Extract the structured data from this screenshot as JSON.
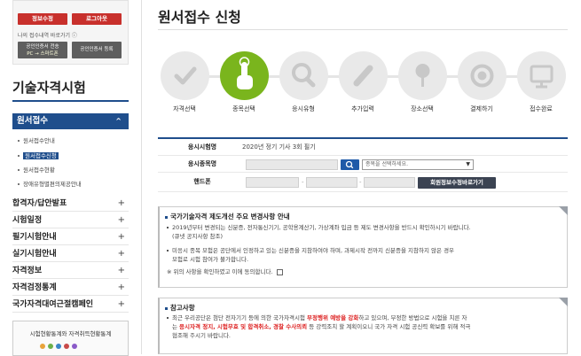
{
  "user_box": {
    "info_edit": "정보수정",
    "logout": "로그아웃",
    "receipt_link": "나의 접수내역 바로가기 ⓘ",
    "cert_transfer_line1": "공인인증서 전송",
    "cert_transfer_line2": "PC → 스마트폰",
    "cert_register": "공인인증서 등록"
  },
  "sidebar": {
    "title": "기술자격시험",
    "active_menu": "원서접수",
    "active_chev": "^",
    "sub_items": [
      "원서접수안내",
      "원서접수신청",
      "원서접수현황",
      "장애유형별편의제공안내"
    ],
    "menus": [
      "합격자/답안발표",
      "시험일정",
      "필기시험안내",
      "실기시험안내",
      "자격정보",
      "자격검정통계",
      "국가자격대여근절캠페인"
    ],
    "plus": "+",
    "stats_title": "시험현황통계와 자격취득현황통계"
  },
  "page": {
    "title": "원서접수 신청"
  },
  "steps": [
    {
      "label": "자격선택",
      "icon": "check-icon"
    },
    {
      "label": "종목선택",
      "icon": "hand-pointer-icon"
    },
    {
      "label": "응시유형",
      "icon": "magnifier-icon"
    },
    {
      "label": "추가입력",
      "icon": "pencil-icon"
    },
    {
      "label": "장소선택",
      "icon": "location-pin-icon"
    },
    {
      "label": "결제하기",
      "icon": "coin-icon"
    },
    {
      "label": "접수완료",
      "icon": "ok-monitor-icon"
    }
  ],
  "form": {
    "exam_label": "응시시험명",
    "exam_value": "2020년 정기 기사 3회 필기",
    "item_label": "응시종목명",
    "item_select": "종목을 선택하세요.",
    "phone_label": "핸드폰",
    "dash": "-",
    "member_button": "회원정보수정바로가기"
  },
  "notice1": {
    "title": "국가기술자격 제도개선 주요 변경사항 안내",
    "line1": "2019년부터 변경되는 신분증, 전자통신기기, 공학용계산기, 가상계좌 입금 등 제도 변경사항을 반드시 확인하시기 바랍니다.",
    "line2": "(큐넷 공지사항 참조)",
    "line3": "미응시 종목 모험은 공단에서 인정하고 있는 신분증을 지참하여야 하며, 과제시작 전까지 신분증을 지참하지 않은 경우",
    "line4": "모험로 시험 참여가 불가합니다.",
    "agree": "※ 위의 사항을 확인하였고 이에 동의합니다."
  },
  "notice2": {
    "title": "참고사항",
    "line1a": "최근 우리공단은 첨단 전자기기 등에 의한 국가자격시험 ",
    "line1b": "부정행위 예방을 강화",
    "line1c": "하고 있으며, 부정한 방법으로 시험을 치른 자",
    "line2a": "는 ",
    "line2b": "응시자격 정지, 시험무효 및 합격취소, 경찰 수사의뢰",
    "line2c": " 등 강력조치 할 계획이오니 국가 자격 시험 공신력 확보를 위해 적극",
    "line3": "협조해 주시기 바랍니다."
  },
  "colors": {
    "accent_blue": "#1f4e8c",
    "active_green": "#7ab51d",
    "logout_red": "#c8302c"
  }
}
